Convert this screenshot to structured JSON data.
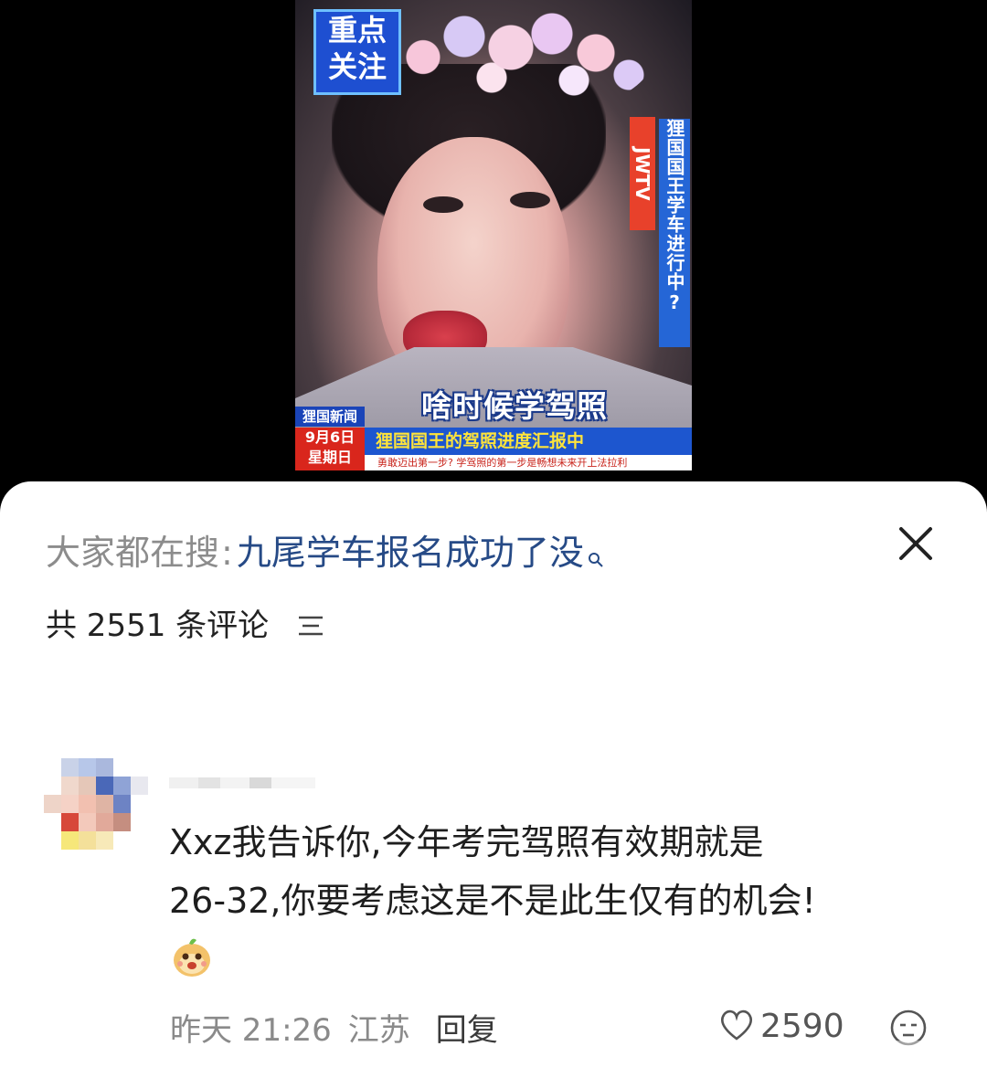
{
  "video": {
    "badge_line1": "重点",
    "badge_line2": "关注",
    "channel": "JWTV",
    "vertical_title": "狸国国王学车进行中?",
    "caption": "啥时候学驾照",
    "news_tag": "狸国新闻",
    "date_line1": "9月6日",
    "date_line2": "星期日",
    "headline": "狸国国王的驾照进度汇报中",
    "ticker": "勇敢迈出第一步? 学驾照的第一步是畅想未来开上法拉利"
  },
  "sheet": {
    "search_prefix": "大家都在搜",
    "search_sep": ":",
    "search_query": "九尾学车报名成功了没",
    "count_label": "共 2551 条评论"
  },
  "comment": {
    "text_line1": "Xxz我告诉你,今年考完驾照有效期就是",
    "text_line2": "26-32,你要考虑这是不是此生仅有的机会!",
    "time": "昨天 21:26",
    "location": "江苏",
    "reply_label": "回复",
    "likes": "2590"
  },
  "colors": {
    "query_blue": "#264a86",
    "muted_gray": "#8c8c8c",
    "headline_yellow": "#ffe43a",
    "news_blue": "#1d56cf",
    "news_red": "#d9261c"
  },
  "icons": [
    "close-icon",
    "sort-icon",
    "search-icon",
    "heart-icon",
    "dislike-face-icon",
    "sticker-emoji"
  ]
}
